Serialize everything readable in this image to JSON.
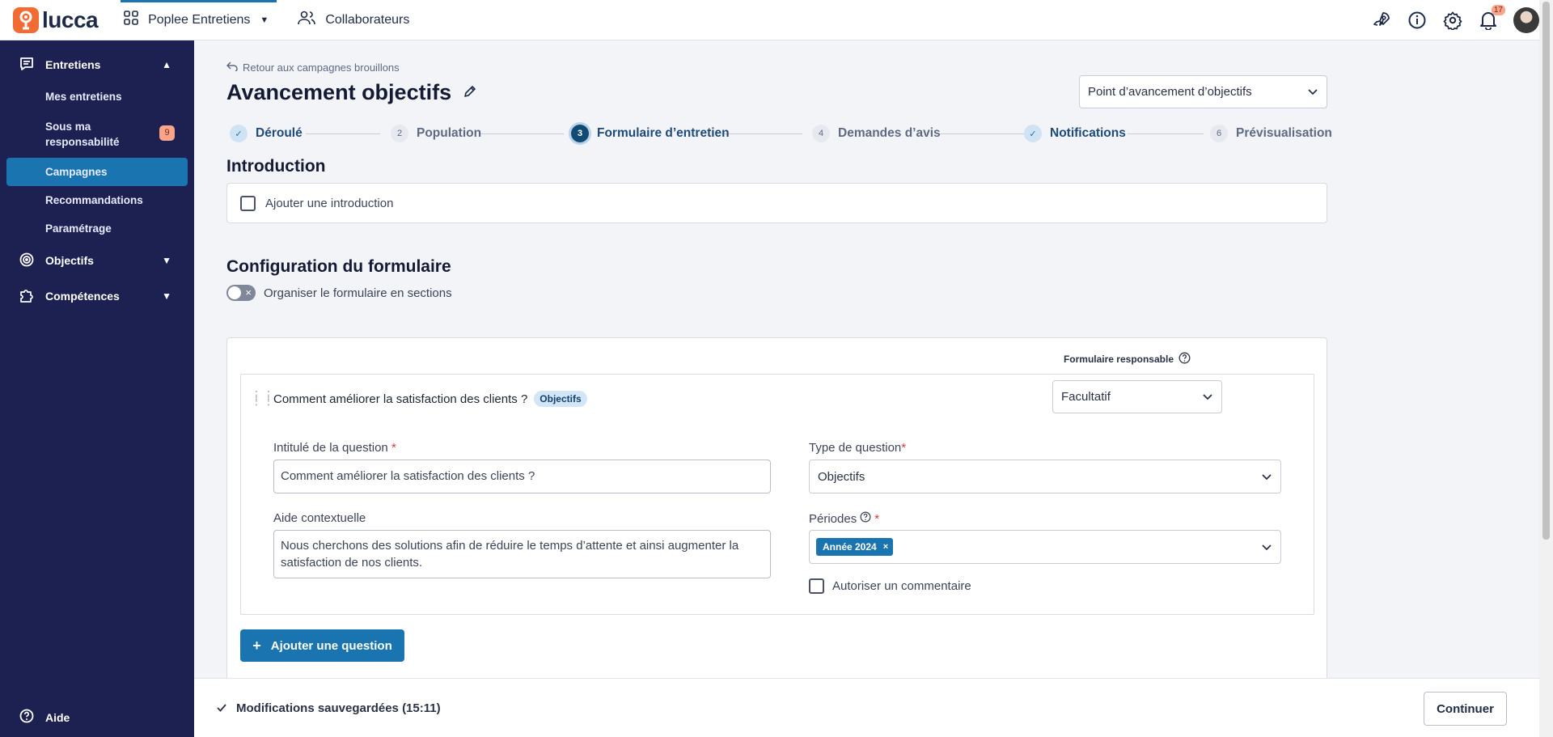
{
  "header": {
    "brand": "lucca",
    "app_name": "Poplee Entretiens",
    "collaborators_label": "Collaborateurs",
    "notification_count": "17"
  },
  "sidebar": {
    "section_entretiens": "Entretiens",
    "items": [
      {
        "label": "Mes entretiens"
      },
      {
        "label": "Sous ma responsabilité",
        "badge": "9"
      },
      {
        "label": "Campagnes"
      },
      {
        "label": "Recommandations"
      },
      {
        "label": "Paramétrage"
      }
    ],
    "section_objectifs": "Objectifs",
    "section_competences": "Compétences",
    "help_label": "Aide"
  },
  "page": {
    "back_link": "Retour aux campagnes brouillons",
    "title": "Avancement objectifs",
    "template_select": "Point d’avancement d’objectifs"
  },
  "stepper": [
    {
      "label": "Déroulé",
      "num": "✓",
      "state": "done"
    },
    {
      "label": "Population",
      "num": "2",
      "state": "todo"
    },
    {
      "label": "Formulaire d’entretien",
      "num": "3",
      "state": "current"
    },
    {
      "label": "Demandes d’avis",
      "num": "4",
      "state": "todo"
    },
    {
      "label": "Notifications",
      "num": "✓",
      "state": "done"
    },
    {
      "label": "Prévisualisation",
      "num": "6",
      "state": "todo"
    }
  ],
  "intro": {
    "heading": "Introduction",
    "checkbox_label": "Ajouter une introduction"
  },
  "config": {
    "heading": "Configuration du formulaire",
    "toggle_label": "Organiser le formulaire en sections",
    "responsible_form_label": "Formulaire responsable"
  },
  "question": {
    "title": "Comment améliorer la satisfaction des clients ?",
    "tag": "Objectifs",
    "responsible_value": "Facultatif",
    "intitule_label": "Intitulé de la question",
    "intitule_value": "Comment améliorer la satisfaction des clients ?",
    "aide_label": "Aide contextuelle",
    "aide_value": "Nous cherchons des solutions afin de réduire le temps d’attente et ainsi augmenter la satisfaction de nos clients.",
    "type_label": "Type de question",
    "type_value": "Objectifs",
    "periodes_label": "Périodes",
    "periode_chip": "Année 2024",
    "comment_label": "Autoriser un commentaire"
  },
  "add_question_label": "Ajouter une question",
  "footer": {
    "saved_text": "Modifications sauvegardées (15:11)",
    "continue_label": "Continuer"
  }
}
